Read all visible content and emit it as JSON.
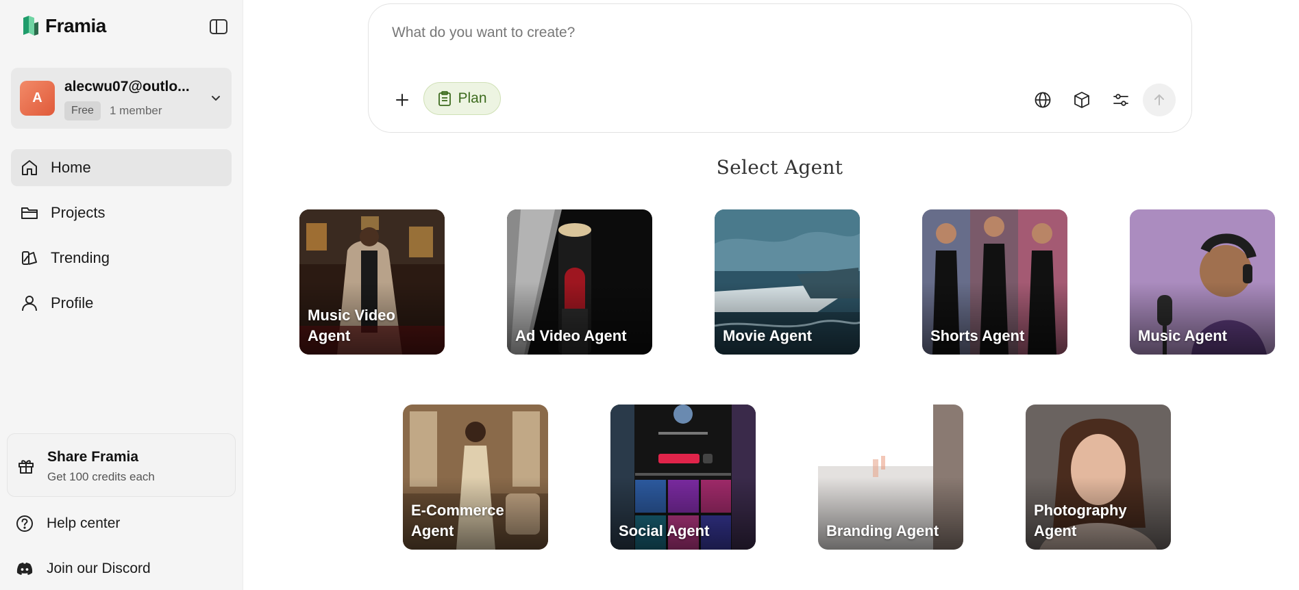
{
  "brand": {
    "name": "Framia"
  },
  "account": {
    "avatar_letter": "A",
    "email": "alecwu07@outlo...",
    "plan": "Free",
    "members": "1 member"
  },
  "nav": [
    {
      "label": "Home",
      "icon": "home-icon",
      "active": true
    },
    {
      "label": "Projects",
      "icon": "folder-icon",
      "active": false
    },
    {
      "label": "Trending",
      "icon": "trending-icon",
      "active": false
    },
    {
      "label": "Profile",
      "icon": "user-icon",
      "active": false
    }
  ],
  "share": {
    "title": "Share Framia",
    "subtitle": "Get 100 credits each"
  },
  "bottom_links": {
    "help": "Help center",
    "discord": "Join our Discord"
  },
  "prompt": {
    "placeholder": "What do you want to create?",
    "plan_label": "Plan"
  },
  "section_title": "Select Agent",
  "agents": [
    {
      "label": "Music Video Agent",
      "theme": "night-street"
    },
    {
      "label": "Ad Video Agent",
      "theme": "lipstick"
    },
    {
      "label": "Movie Agent",
      "theme": "yacht"
    },
    {
      "label": "Shorts Agent",
      "theme": "dancers"
    },
    {
      "label": "Music Agent",
      "theme": "singer"
    },
    {
      "label": "E-Commerce Agent",
      "theme": "gown"
    },
    {
      "label": "Social Agent",
      "theme": "social-feed"
    },
    {
      "label": "Branding Agent",
      "theme": "branding"
    },
    {
      "label": "Photography Agent",
      "theme": "portrait"
    }
  ],
  "colors": {
    "sidebar_bg": "#f5f5f5",
    "active_nav_bg": "#e6e6e6",
    "plan_button_bg": "#edf4e2",
    "plan_button_text": "#3d6b1e",
    "avatar": "#e8704f"
  }
}
